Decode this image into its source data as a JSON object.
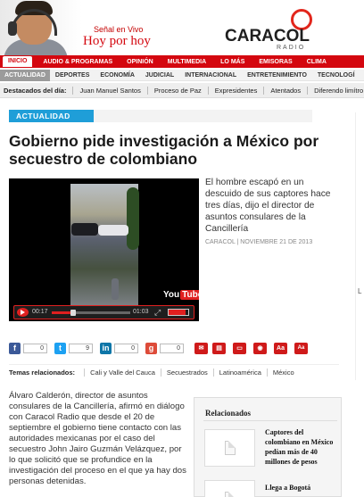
{
  "header": {
    "live_label": "Señal en Vivo",
    "show_title": "Hoy por hoy",
    "brand": "CARACOL",
    "brand_sub": "RADIO"
  },
  "main_nav": {
    "items": [
      {
        "label": "INICIO",
        "active": true
      },
      {
        "label": "AUDIO & PROGRAMAS"
      },
      {
        "label": "OPINIÓN"
      },
      {
        "label": "MULTIMEDIA"
      },
      {
        "label": "LO MÁS"
      },
      {
        "label": "EMISORAS"
      },
      {
        "label": "CLIMA"
      }
    ]
  },
  "sub_nav": {
    "items": [
      {
        "label": "ACTUALIDAD",
        "active": true
      },
      {
        "label": "DEPORTES"
      },
      {
        "label": "ECONOMÍA"
      },
      {
        "label": "JUDICIAL"
      },
      {
        "label": "INTERNACIONAL"
      },
      {
        "label": "ENTRETENIMIENTO"
      },
      {
        "label": "TECNOLOGÍ"
      }
    ]
  },
  "highlights": {
    "label": "Destacados del día:",
    "items": [
      "Juan Manuel Santos",
      "Proceso de Paz",
      "Expresidentes",
      "Atentados",
      "Diferendo limítro"
    ]
  },
  "article": {
    "section": "ACTUALIDAD",
    "headline": "Gobierno pide investigación a México por secuestro de colombiano",
    "lead": "El hombre escapó en un descuido de sus captores hace tres días, dijo el director de asuntos consulares de la Cancillería",
    "byline": "CARACOL | NOVIEMBRE 21 DE 2013",
    "body": "Álvaro Calderón, director de asuntos consulares de la Cancillería, afirmó en diálogo con Caracol Radio que desde el 20 de septiembre el gobierno tiene contacto con las autoridades mexicanas por el caso del secuestro John Jairo Guzmán Velázquez, por lo que solicitó que se profundice en la investigación del proceso en el que ya hay dos personas detenidas."
  },
  "video": {
    "current_time": "00:17",
    "total_time": "01:03",
    "progress": 0.27,
    "volume": 0.85,
    "youtube_label": "You",
    "youtube_label_box": "Tube"
  },
  "share": {
    "facebook_count": "0",
    "twitter_count": "9",
    "linkedin_count": "0",
    "gplus_count": "0",
    "tools": [
      "mail-icon",
      "print-icon",
      "comment-icon",
      "share-icon",
      "font-larger-icon",
      "font-smaller-icon"
    ],
    "font_large_label": "Aa",
    "font_small_label": "Aa"
  },
  "related_topics": {
    "label": "Temas relacionados:",
    "tags": [
      "Cali y Valle del Cauca",
      "Secuestrados",
      "Latinoamérica",
      "México"
    ]
  },
  "related": {
    "title": "Relacionados",
    "items": [
      {
        "text": "Captores del colombiano en México pedían más de 40 millones de pesos"
      },
      {
        "text": "Llega a Bogotá"
      }
    ]
  },
  "edge": {
    "letter": "L"
  },
  "colors": {
    "brand_red": "#d4070f",
    "section_blue": "#1f9ed8"
  }
}
